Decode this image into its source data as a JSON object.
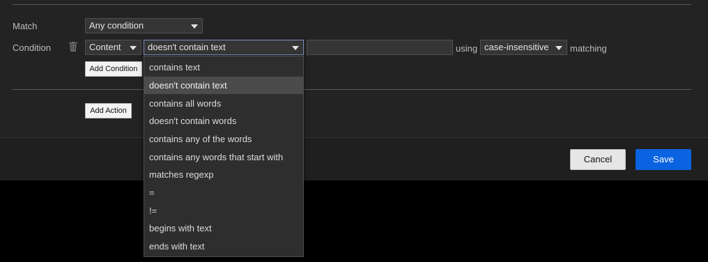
{
  "match": {
    "label": "Match",
    "value": "Any condition"
  },
  "condition": {
    "label": "Condition",
    "field": "Content",
    "operator": "doesn't contain text",
    "text_value": "",
    "using_label": "using",
    "case_mode": "case-insensitive",
    "matching_label": "matching"
  },
  "buttons": {
    "add_condition": "Add Condition",
    "add_action": "Add Action",
    "cancel": "Cancel",
    "save": "Save"
  },
  "operator_options": [
    "contains text",
    "doesn't contain text",
    "contains all words",
    "doesn't contain words",
    "contains any of the words",
    "contains any words that start with",
    "matches regexp",
    "=",
    "!=",
    "begins with text",
    "ends with text"
  ],
  "selected_option_index": 1,
  "colors": {
    "accent": "#0a63e0",
    "panel": "#232323",
    "dropdown_highlight": "#4b4b4b"
  }
}
